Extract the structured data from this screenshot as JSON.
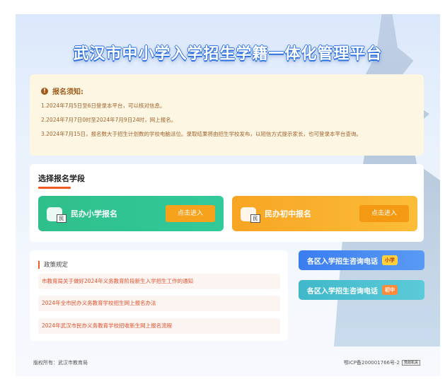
{
  "header": {
    "title": "武汉市中小学入学招生学籍一体化管理平台"
  },
  "notice": {
    "heading": "报名须知:",
    "lines": [
      "1.2024年7月5日至6日登录本平台，可以核对信息。",
      "2.2024年7月7日0时至2024年7月9日24时，网上报名。",
      "3.2024年7月15日，报名数大于招生计划数的学校电脑派位。录取结果将由招生学校发布，以短信方式提示家长，也可登录本平台查询。"
    ]
  },
  "stage": {
    "title": "选择报名学段",
    "primary": {
      "label": "民办小学报名",
      "button": "点击进入",
      "tag": "民"
    },
    "middle": {
      "label": "民办初中报名",
      "button": "点击进入",
      "tag": "民"
    }
  },
  "policy": {
    "heading": "政策规定",
    "links": [
      "市教育局关于做好2024年义务教育阶段新生入学招生工作的通知",
      "2024年全市民办义务教育学校招生网上报名办法",
      "2024年武汉市民办义务教育学校招收新生网上报名流程"
    ]
  },
  "hotlines": {
    "primary": {
      "label": "各区入学招生咨询电话",
      "badge": "小学"
    },
    "middle": {
      "label": "各区入学招生咨询电话",
      "badge": "初中"
    }
  },
  "footer": {
    "copyright": "版权所有：武汉市教育局",
    "icp": "鄂ICP备200001766号-2",
    "gov_badge": "党政机关"
  },
  "colors": {
    "accent_orange": "#f05a24",
    "primary_green": "#2fbf8a",
    "middle_orange": "#f7a523",
    "hotline_blue": "#3a7df0",
    "hotline_teal": "#3fb8c9"
  }
}
